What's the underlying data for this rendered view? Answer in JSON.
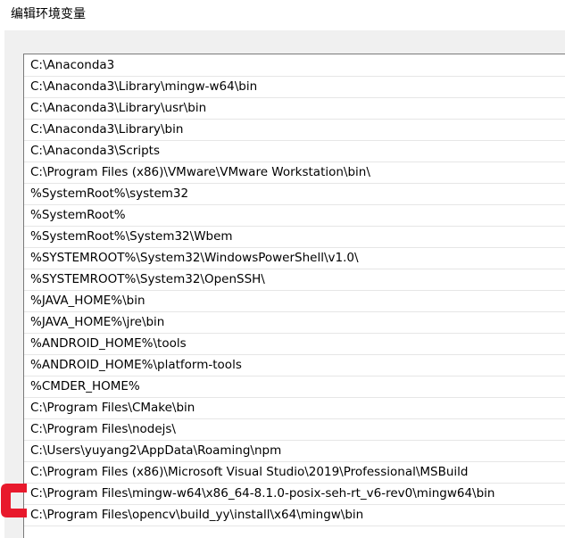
{
  "window": {
    "title": "编辑环境变量"
  },
  "path_list": {
    "items": [
      "C:\\Anaconda3",
      "C:\\Anaconda3\\Library\\mingw-w64\\bin",
      "C:\\Anaconda3\\Library\\usr\\bin",
      "C:\\Anaconda3\\Library\\bin",
      "C:\\Anaconda3\\Scripts",
      "C:\\Program Files (x86)\\VMware\\VMware Workstation\\bin\\",
      "%SystemRoot%\\system32",
      "%SystemRoot%",
      "%SystemRoot%\\System32\\Wbem",
      "%SYSTEMROOT%\\System32\\WindowsPowerShell\\v1.0\\",
      "%SYSTEMROOT%\\System32\\OpenSSH\\",
      "%JAVA_HOME%\\bin",
      "%JAVA_HOME%\\jre\\bin",
      "%ANDROID_HOME%\\tools",
      "%ANDROID_HOME%\\platform-tools",
      "%CMDER_HOME%",
      "C:\\Program Files\\CMake\\bin",
      "C:\\Program Files\\nodejs\\",
      "C:\\Users\\yuyang2\\AppData\\Roaming\\npm",
      "C:\\Program Files (x86)\\Microsoft Visual Studio\\2019\\Professional\\MSBuild",
      "C:\\Program Files\\mingw-w64\\x86_64-8.1.0-posix-seh-rt_v6-rev0\\mingw64\\bin",
      "C:\\Program Files\\opencv\\build_yy\\install\\x64\\mingw\\bin"
    ]
  },
  "colors": {
    "dialog_background": "#f0f0f0",
    "list_background": "#ffffff",
    "row_separator": "#e6e6e6",
    "annotation_marker": "#e8192c"
  },
  "icons": {
    "annotation": "red-highlight-marker"
  }
}
